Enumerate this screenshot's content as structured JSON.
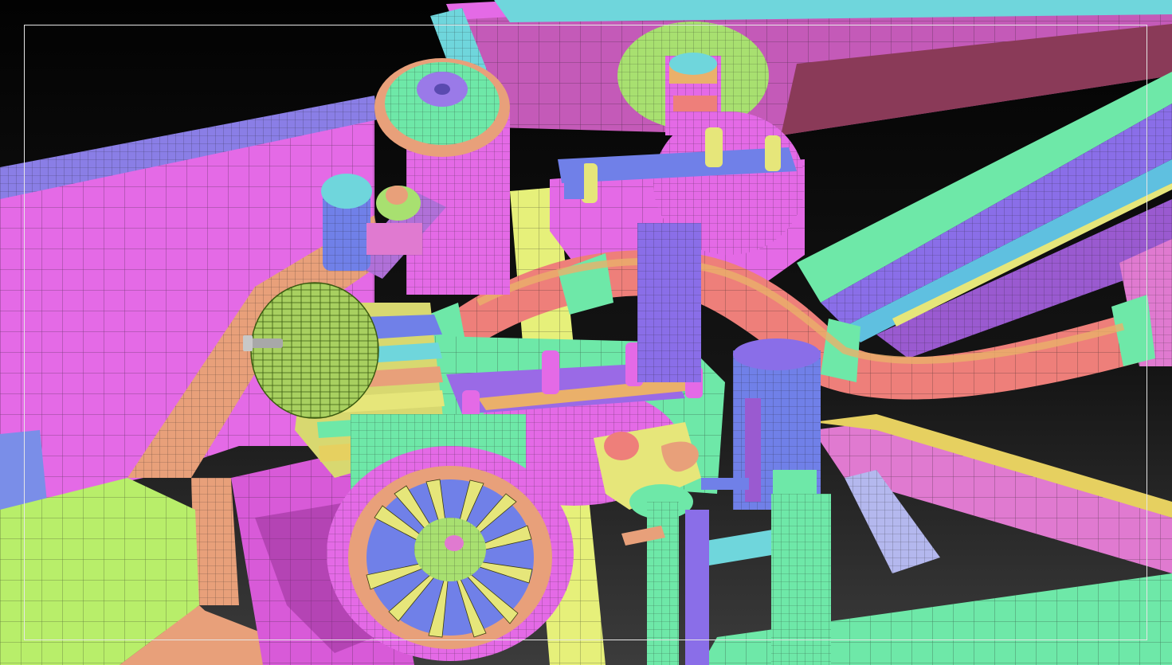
{
  "viewport": {
    "background_top": "#050505",
    "background_bottom": "#3a3a3a",
    "safe_frame_color": "#e6e6e6"
  },
  "palette": {
    "magenta": "#e46ae6",
    "magenta_dark": "#b04cb8",
    "pink": "#e07ad0",
    "cyan": "#6fd6dc",
    "teal_green": "#5fe0a0",
    "mint": "#6ee8a8",
    "green_light": "#9ee870",
    "yellow_green": "#d8ee7a",
    "peach": "#e8a07a",
    "salmon": "#ee7f7a",
    "orange": "#eab06a",
    "blue": "#7080e8",
    "violet": "#8a6ee8",
    "purple": "#9a5ad0",
    "lavender": "#b48aee",
    "wire": "#1a1a1a"
  }
}
